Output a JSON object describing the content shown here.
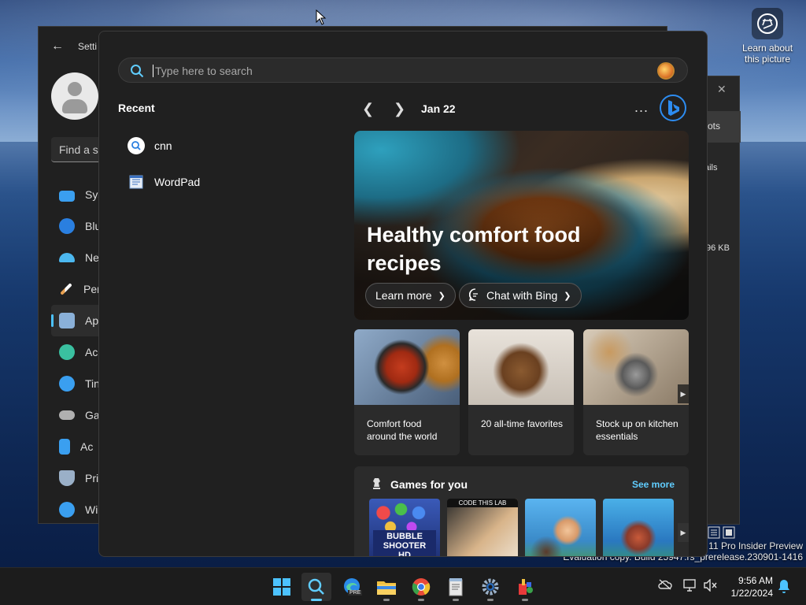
{
  "desktop": {
    "spotlight_label": "Learn about this picture",
    "watermark_line1": "s 11 Pro Insider Preview",
    "watermark_line2": "Evaluation copy. Build 25947.rs_prerelease.230901-1416"
  },
  "settings_window": {
    "title": "Setti",
    "search_placeholder": "Find a se",
    "nav": [
      {
        "label": "Sys",
        "icon": "system-icon",
        "color": "#3a9ff0"
      },
      {
        "label": "Blu",
        "icon": "bluetooth-icon",
        "color": "#2a7fe0"
      },
      {
        "label": "Ne",
        "icon": "network-icon",
        "color": "#4cb8f0"
      },
      {
        "label": "Per",
        "icon": "personalization-icon",
        "color": "#e8a050"
      },
      {
        "label": "Ap",
        "icon": "apps-icon",
        "color": "#8ab0d8"
      },
      {
        "label": "Ac",
        "icon": "accounts-icon",
        "color": "#3ac0a0"
      },
      {
        "label": "Tin",
        "icon": "time-language-icon",
        "color": "#3a9ff0"
      },
      {
        "label": "Ga",
        "icon": "gaming-icon",
        "color": "#b0b0b0"
      },
      {
        "label": "Ac",
        "icon": "accessibility-icon",
        "color": "#3a9ff0"
      },
      {
        "label": "Pri",
        "icon": "privacy-icon",
        "color": "#9ab0c8"
      },
      {
        "label": "Wi",
        "icon": "windows-update-icon",
        "color": "#3a9ff0"
      }
    ]
  },
  "background_window": {
    "row1": "ots",
    "row2": "ails",
    "row3": "96 KB"
  },
  "search_panel": {
    "placeholder": "Type here to search",
    "recent_title": "Recent",
    "recent": [
      {
        "label": "cnn",
        "icon": "search-icon"
      },
      {
        "label": "WordPad",
        "icon": "wordpad-icon"
      }
    ],
    "date": "Jan 22",
    "more_label": "...",
    "hero": {
      "title": "Healthy comfort food recipes",
      "learn_more": "Learn more",
      "chat": "Chat with Bing"
    },
    "cards": [
      {
        "title": "Comfort food around the world"
      },
      {
        "title": "20 all-time favorites"
      },
      {
        "title": "Stock up on kitchen essentials"
      }
    ],
    "games": {
      "title": "Games for you",
      "see_more": "See more",
      "tiles": [
        {
          "label": "BUBBLE SHOOTER HD"
        },
        {
          "label": "CODE THIS LAB"
        },
        {
          "label": ""
        },
        {
          "label": ""
        }
      ]
    }
  },
  "taskbar": {
    "time": "9:56 AM",
    "date": "1/22/2024",
    "edge_badge": "PRE"
  }
}
